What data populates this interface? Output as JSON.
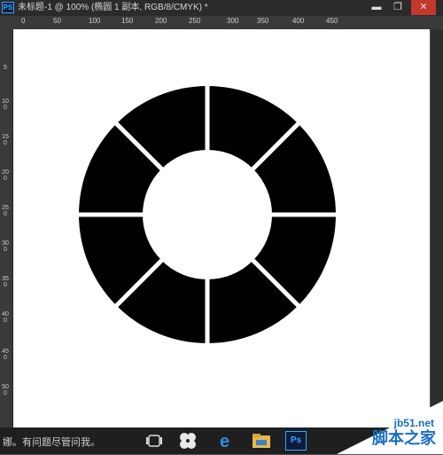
{
  "window": {
    "app_icon": "PS",
    "title": "未标题-1 @ 100% (椭圆 1 副本, RGB/8/CMYK) *",
    "min_glyph": "▬",
    "max_glyph": "❐",
    "close_glyph": "✕"
  },
  "ruler_h": [
    "0",
    "50",
    "100",
    "150",
    "200",
    "250",
    "300",
    "350",
    "400",
    "450"
  ],
  "ruler_v": [
    "5",
    "100",
    "150",
    "200",
    "250",
    "300",
    "350",
    "400",
    "450",
    "500"
  ],
  "taskbar": {
    "search_hint": "娜。有问题尽管问我。",
    "ps_label": "Ps"
  },
  "watermark": {
    "url": "jb51.net",
    "name": "脚本之家"
  },
  "colors": {
    "shape_fill": "#000000",
    "canvas": "#ffffff",
    "workspace": "#535353",
    "watermark_blue": "#1a6fc4"
  }
}
